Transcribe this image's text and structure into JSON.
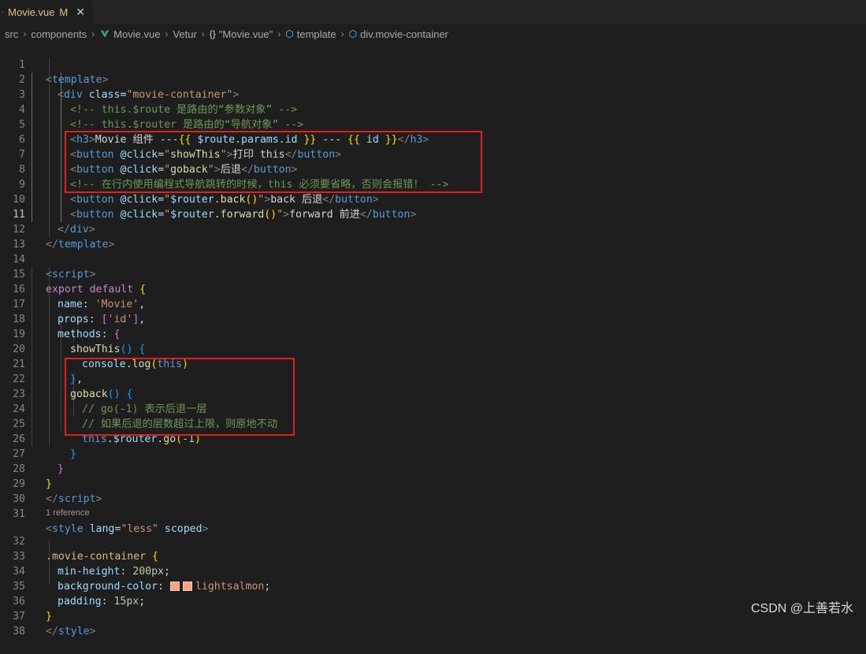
{
  "tab": {
    "filename": "Movie.vue",
    "modified": "M",
    "close": "✕"
  },
  "breadcrumb": [
    "src",
    "components",
    "Movie.vue",
    "Vetur",
    "\"Movie.vue\"",
    "template",
    "div.movie-container"
  ],
  "codelens": "1 reference",
  "line_numbers": [
    "1",
    "2",
    "3",
    "4",
    "5",
    "6",
    "7",
    "8",
    "9",
    "10",
    "11",
    "12",
    "13",
    "14",
    "15",
    "16",
    "17",
    "18",
    "19",
    "20",
    "21",
    "22",
    "23",
    "24",
    "25",
    "26",
    "27",
    "28",
    "29",
    "30",
    "31",
    "32",
    "33",
    "34",
    "35",
    "36",
    "37",
    "38"
  ],
  "active_line": "11",
  "code": {
    "l1": [
      "<",
      "template",
      ">"
    ],
    "l2": [
      "<",
      "div",
      " ",
      "class",
      "=",
      "\"movie-container\"",
      ">"
    ],
    "l3": "<!-- this.$route 是路由的“参数对象” -->",
    "l4": "<!-- this.$router 是路由的“导航对象” -->",
    "l5": [
      "<",
      "h3",
      ">",
      "Movie 组件 ---",
      "{{",
      " ",
      "$route",
      ".",
      "params",
      ".",
      "id",
      " ",
      "}}",
      " --- ",
      "{{",
      " ",
      "id",
      " ",
      "}}",
      "</",
      "h3",
      ">"
    ],
    "l6": [
      "<",
      "button",
      " ",
      "@click",
      "=",
      "\"",
      "showThis",
      "\"",
      ">",
      "打印 this",
      "</",
      "button",
      ">"
    ],
    "l7": [
      "<",
      "button",
      " ",
      "@click",
      "=",
      "\"",
      "goback",
      "\"",
      ">",
      "后退",
      "</",
      "button",
      ">"
    ],
    "l8": "<!-- 在行内使用编程式导航跳转的时候，this 必须要省略，否则会报错！ -->",
    "l9": [
      "<",
      "button",
      " ",
      "@click",
      "=",
      "\"",
      "$router",
      ".",
      "back",
      "()",
      "\"",
      ">",
      "back 后退",
      "</",
      "button",
      ">"
    ],
    "l10": [
      "<",
      "button",
      " ",
      "@click",
      "=",
      "\"",
      "$router",
      ".",
      "forward",
      "()",
      "\"",
      ">",
      "forward 前进",
      "</",
      "button",
      ">"
    ],
    "l11": [
      "</",
      "div",
      ">"
    ],
    "l12": [
      "</",
      "template",
      ">"
    ],
    "l14": [
      "<",
      "script",
      ">"
    ],
    "l15": [
      "export",
      " ",
      "default",
      " ",
      "{"
    ],
    "l16": [
      "name",
      ": ",
      "'Movie'",
      ","
    ],
    "l17": [
      "props",
      ": ",
      "[",
      "'id'",
      "]",
      ","
    ],
    "l18": [
      "methods",
      ": ",
      "{"
    ],
    "l19": [
      "showThis",
      "()",
      " ",
      "{"
    ],
    "l20": [
      "console",
      ".",
      "log",
      "(",
      "this",
      ")"
    ],
    "l21": [
      "}",
      ","
    ],
    "l22": [
      "goback",
      "()",
      " ",
      "{"
    ],
    "l23": "// go(-1) 表示后退一层",
    "l24": "// 如果后退的层数超过上限，则原地不动",
    "l25": [
      "this",
      ".",
      "$router",
      ".",
      "go",
      "(",
      "-1",
      ")"
    ],
    "l26": "}",
    "l27": "}",
    "l28": "}",
    "l29": [
      "</",
      "script",
      ">"
    ],
    "l31": [
      "<",
      "style",
      " ",
      "lang",
      "=",
      "\"less\"",
      " ",
      "scoped",
      ">"
    ],
    "l32": [
      ".movie-container",
      " ",
      "{"
    ],
    "l33": [
      "min-height",
      ": ",
      "200px",
      ";"
    ],
    "l34": [
      "background-color",
      ": ",
      "lightsalmon",
      ";"
    ],
    "l35": [
      "padding",
      ": ",
      "15px",
      ";"
    ],
    "l36": "}",
    "l37": [
      "</",
      "style",
      ">"
    ]
  },
  "colors": {
    "highlight_box": "#e0201a",
    "swatch": "#ffa07a"
  },
  "watermark": "CSDN @上善若水"
}
